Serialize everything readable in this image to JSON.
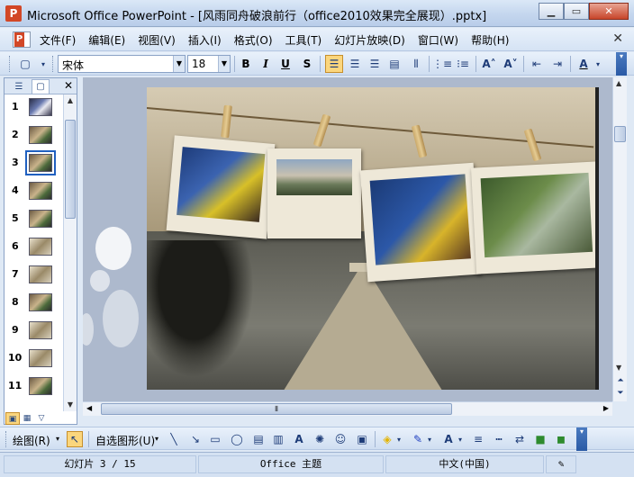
{
  "window": {
    "title": "Microsoft Office PowerPoint - [风雨同舟破浪前行（office2010效果完全展现）.pptx]"
  },
  "menubar": {
    "items": [
      "文件(F)",
      "编辑(E)",
      "视图(V)",
      "插入(I)",
      "格式(O)",
      "工具(T)",
      "幻灯片放映(D)",
      "窗口(W)",
      "帮助(H)"
    ]
  },
  "format_toolbar": {
    "font_name": "宋体",
    "font_size": "18",
    "bold": "B",
    "italic": "I",
    "underline": "U",
    "shadow": "S"
  },
  "slides_panel": {
    "numbers": [
      "1",
      "2",
      "3",
      "4",
      "5",
      "6",
      "7",
      "8",
      "9",
      "10",
      "11"
    ],
    "selected": "3"
  },
  "drawing_toolbar": {
    "draw_label": "绘图(R)",
    "autoshapes_label": "自选图形(U)"
  },
  "statusbar": {
    "slide_info": "幻灯片 3 / 15",
    "theme": "Office 主题",
    "language": "中文(中国)"
  },
  "colors": {
    "accent": "#d24726",
    "selection": "#fbd67d"
  }
}
